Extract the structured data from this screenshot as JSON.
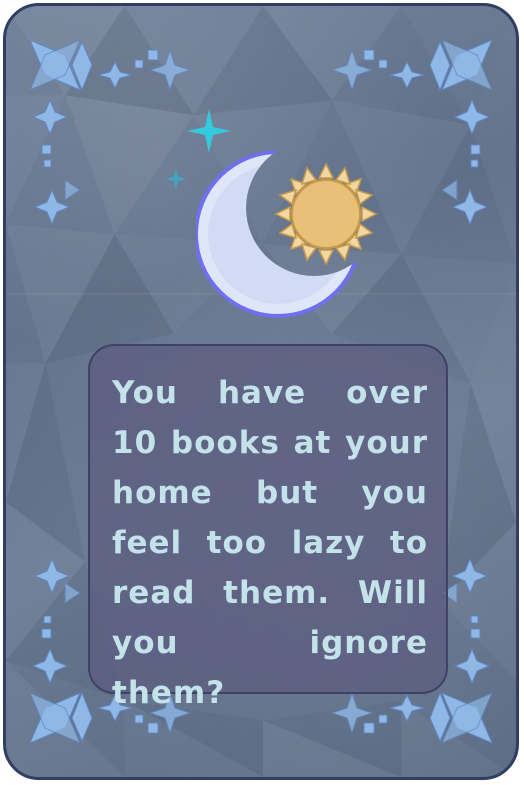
{
  "card": {
    "prompt_text": "You have over 10 books at your home but you feel too lazy to read them. Will you ignore them?",
    "icon": "moon-and-sun-icon"
  },
  "colors": {
    "card_background": "#65758d",
    "card_border": "#2f3f62",
    "panel_background": "#5c5c80",
    "text": "#c4e2ea",
    "moon": "#dfe6f8",
    "moon_outline": "#6f6ff0",
    "sun": "#e8c077",
    "sun_rays": "#f2d8a0",
    "star_accent": "#2fd0e6",
    "ornament": "#8fb8e6"
  }
}
